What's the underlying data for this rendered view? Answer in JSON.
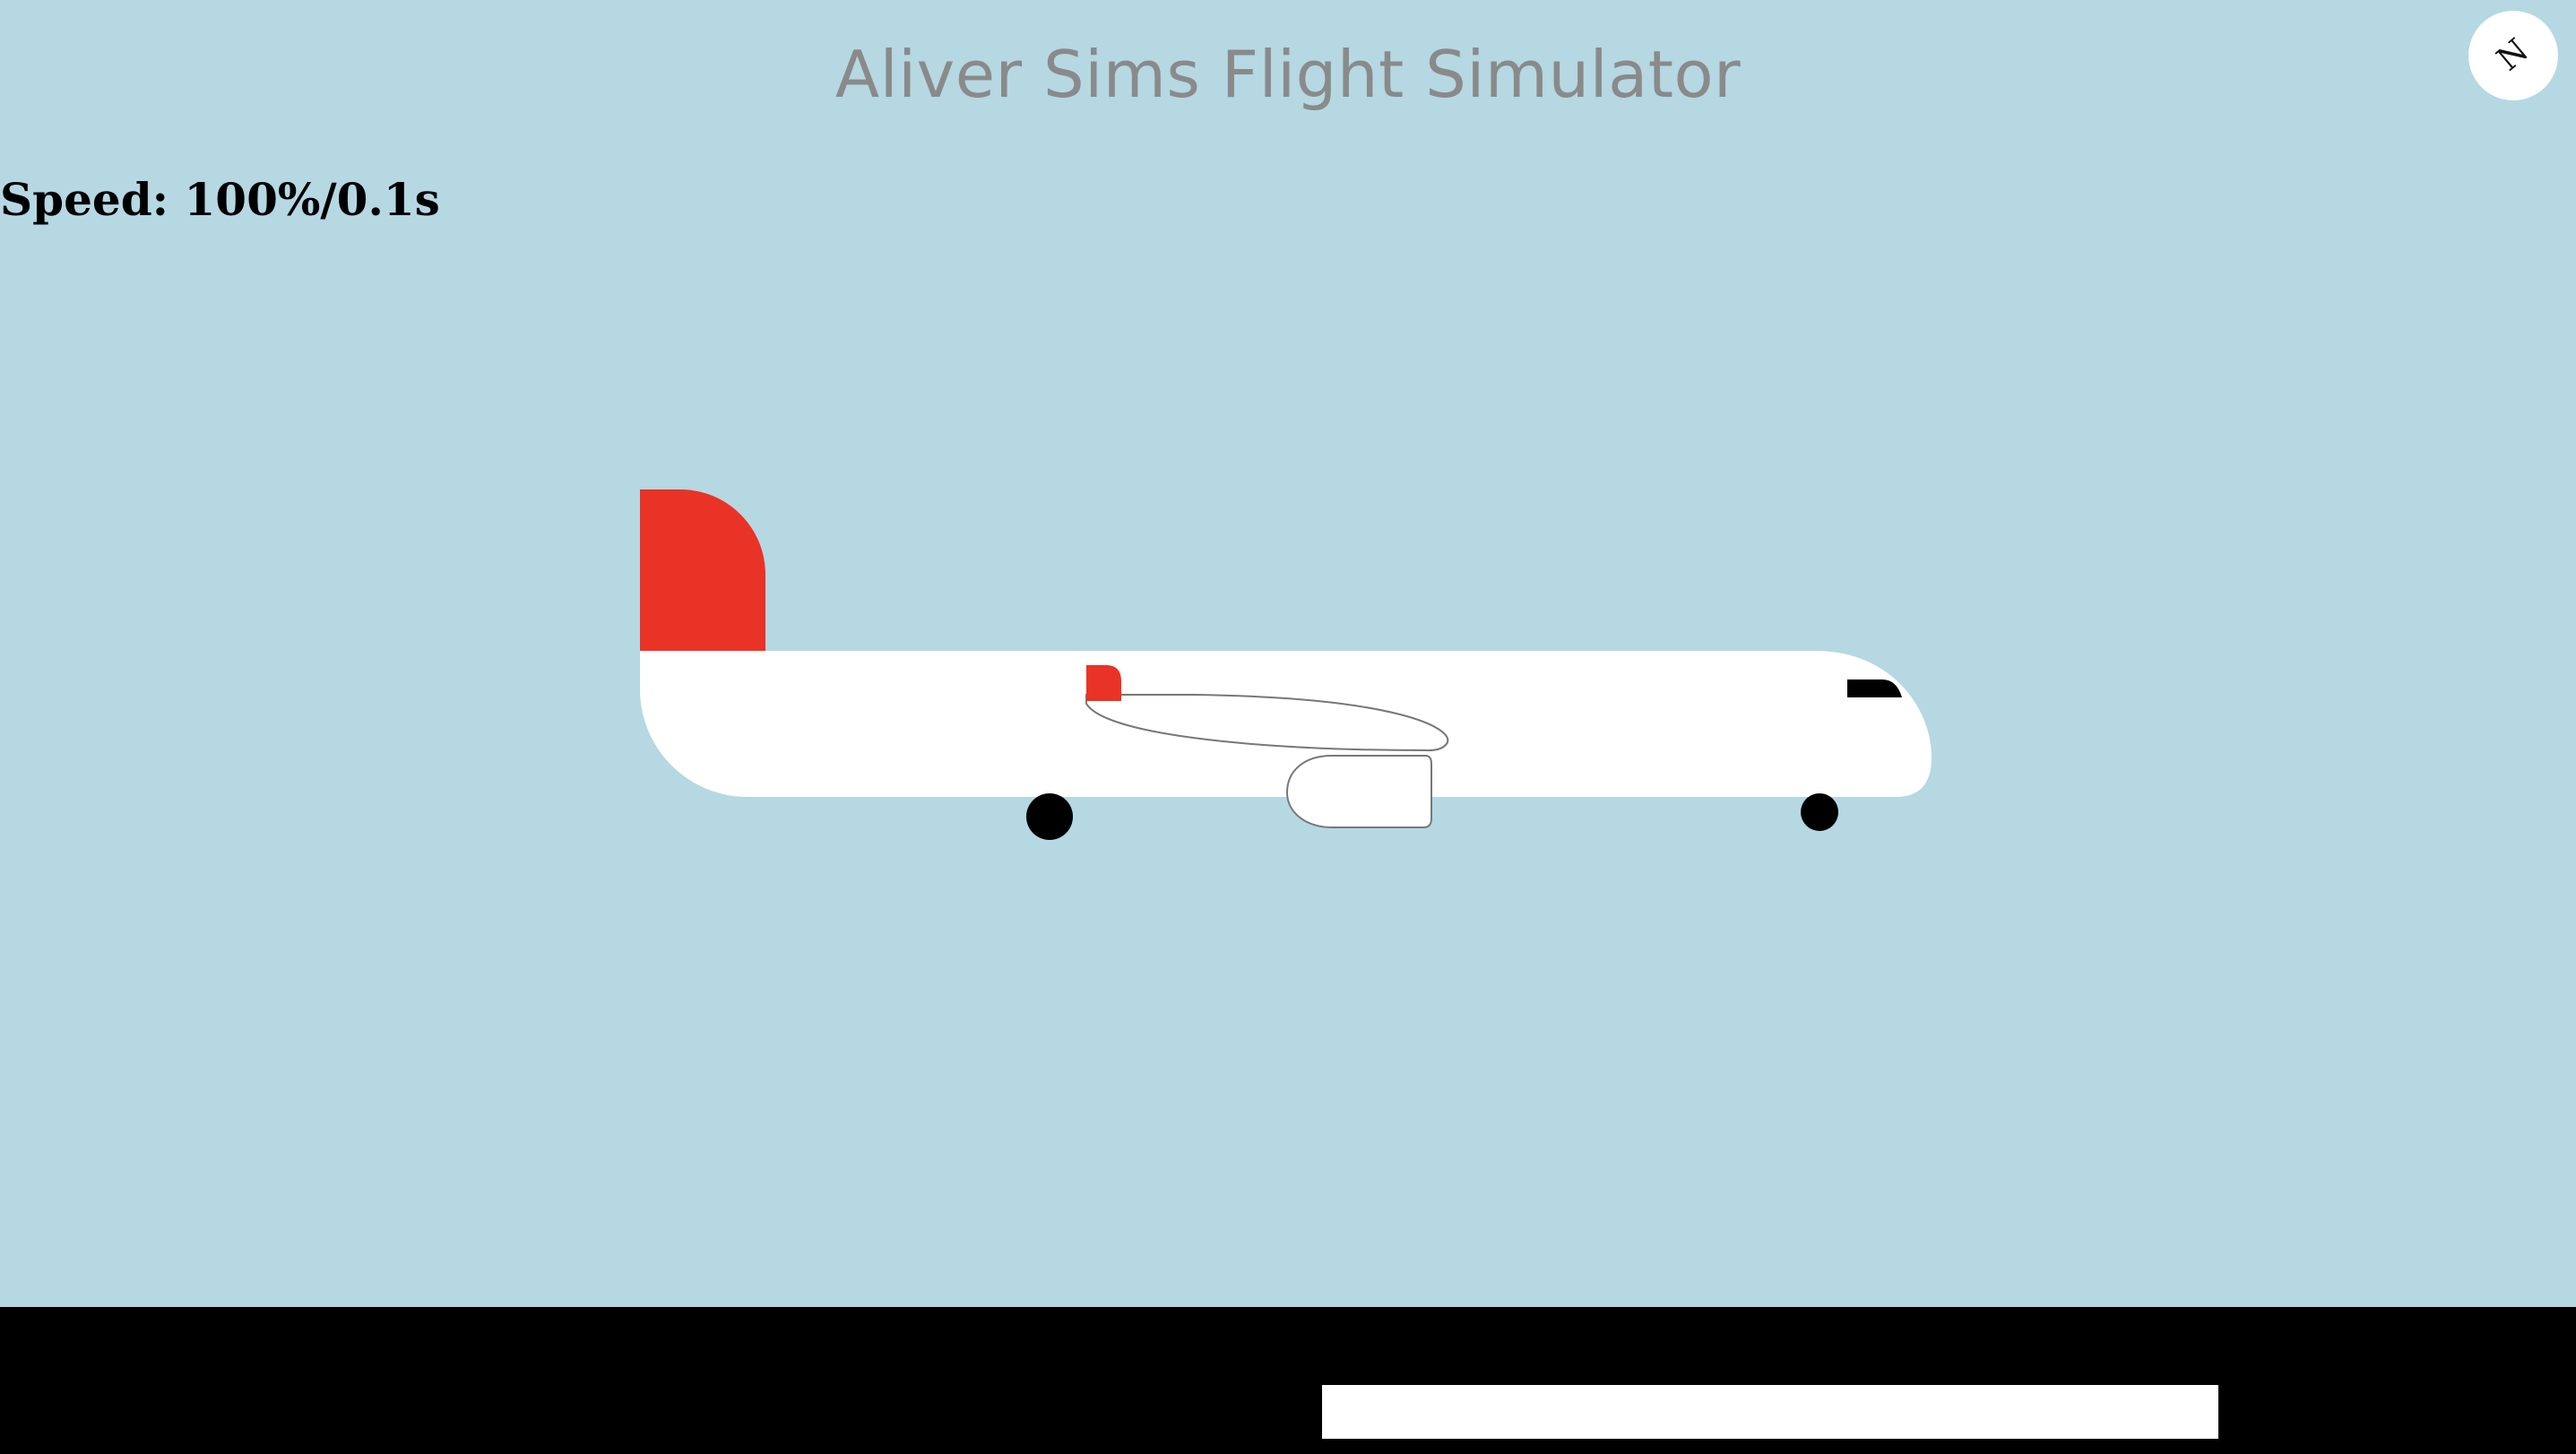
{
  "header": {
    "title": "Aliver Sims Flight Simulator"
  },
  "hud": {
    "speed_text": "Speed: 100%/0.1s"
  },
  "compass": {
    "letter": "N",
    "icon": "compass-icon"
  },
  "aircraft": {
    "body_color": "#ffffff",
    "tail_color": "#e93326",
    "window_color": "#000000",
    "wheel_color": "#000000",
    "outline_color": "#777777"
  },
  "scene": {
    "sky_color": "#b5d8e3",
    "ground_color": "#000000",
    "runway_color": "#ffffff"
  }
}
